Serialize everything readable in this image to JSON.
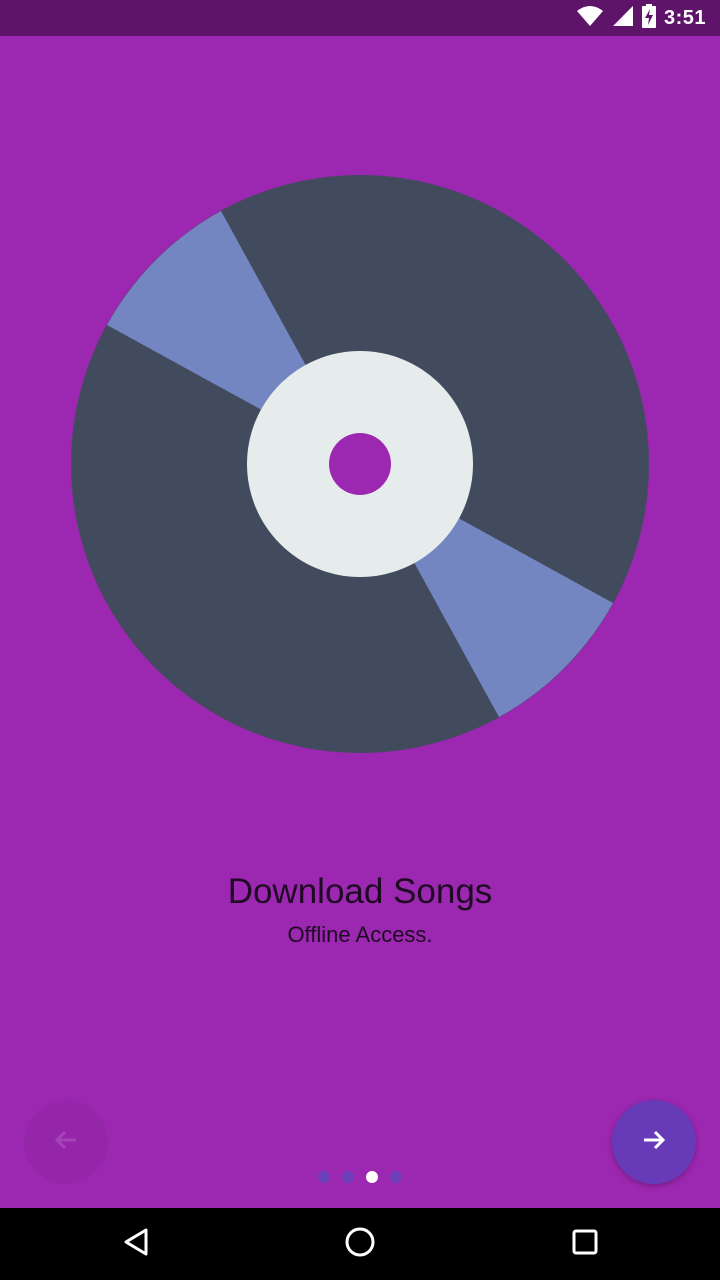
{
  "status_bar": {
    "time": "3:51",
    "icons": [
      "wifi-icon",
      "signal-icon",
      "battery-charging-icon"
    ]
  },
  "illustration": {
    "name": "vinyl-disc-illustration",
    "colors": {
      "background": "#9c27b0",
      "disc": "#424b5e",
      "highlight": "#7386c2",
      "label": "#e6ecec",
      "hole": "#9c27b0"
    }
  },
  "content": {
    "title": "Download Songs",
    "subtitle": "Offline Access."
  },
  "navigation": {
    "prev_icon": "arrow-left-icon",
    "next_icon": "arrow-right-icon",
    "page_count": 4,
    "current_page": 3
  },
  "system_nav": {
    "icons": [
      "back-icon",
      "home-icon",
      "recents-icon"
    ]
  },
  "colors": {
    "accent": "#673ab7",
    "status_bar": "#5e1569",
    "text": "#1f0a24"
  }
}
